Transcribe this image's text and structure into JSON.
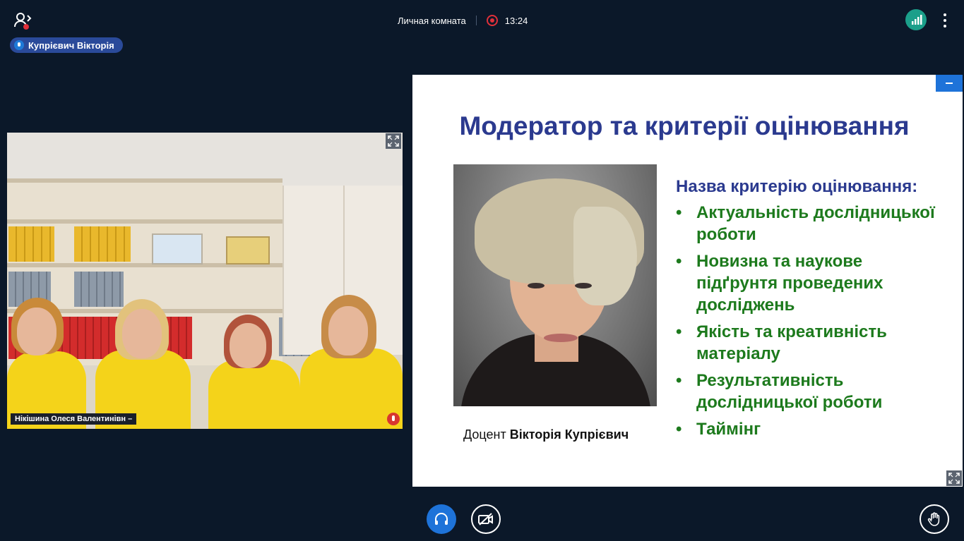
{
  "header": {
    "room_name": "Личная комната",
    "recording_time": "13:24"
  },
  "talking_indicator": {
    "speaker_name": "Купрієвич Вікторія"
  },
  "webcam": {
    "participant_name": "Нікішина Олеся Валентинівн –"
  },
  "slide": {
    "title": "Модератор та критерії оцінювання",
    "caption_prefix": "Доцент ",
    "caption_name": "Вікторія Купрієвич",
    "criteria_heading": "Назва критерію оцінювання:",
    "criteria": [
      "Актуальність дослідницької роботи",
      "Новизна та наукове підґрунтя проведених досліджень",
      "Якість та креативність матеріалу",
      "Результативність дослідницької роботи",
      "Таймінг"
    ]
  },
  "colors": {
    "background": "#0b1829",
    "accent_blue": "#1e73d9",
    "connection_green": "#1b9f8a",
    "recording_red": "#e0303a",
    "slide_title": "#2b3a8f",
    "slide_list": "#1d7a1d"
  },
  "icons": {
    "users": "users-icon",
    "connection": "signal-bars-icon",
    "more": "more-vertical-icon",
    "audio": "headphones-icon",
    "video": "video-off-icon",
    "hand": "raise-hand-icon",
    "expand": "expand-icon",
    "minimize": "minimize-icon"
  }
}
